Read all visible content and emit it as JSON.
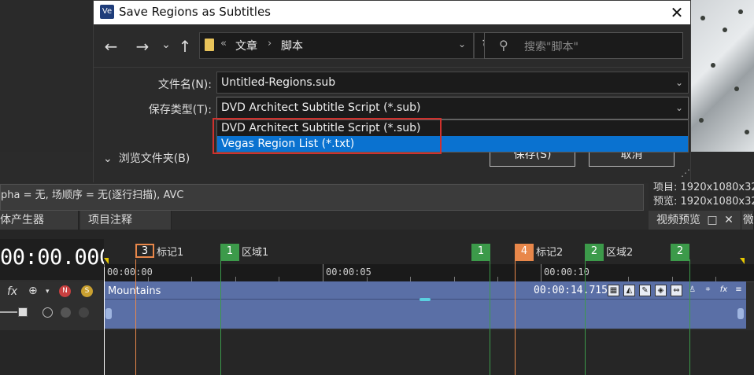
{
  "dialog": {
    "title": "Save Regions as Subtitles",
    "title_icon": "Ve",
    "nav": {
      "back": "←",
      "forward": "→",
      "recent": "⌄",
      "up": "↑",
      "refresh": "↻"
    },
    "breadcrumb": [
      "文章",
      "脚本"
    ],
    "breadcrumb_prefix": "«",
    "search_placeholder": "搜索\"脚本\"",
    "filename_label": "文件名(N):",
    "filename_value": "Untitled-Regions.sub",
    "filetype_label": "保存类型(T):",
    "filetype_value": "DVD Architect Subtitle Script (*.sub)",
    "filetype_options": [
      "DVD Architect Subtitle Script (*.sub)",
      "Vegas Region List (*.txt)"
    ],
    "filetype_highlighted": "Vegas Region List (*.txt)",
    "browse_folders": "浏览文件夹(B)",
    "save_button": "保存(S)",
    "cancel_button": "取消"
  },
  "background": {
    "media_info": "pha = 无, 场顺序 = 无(逐行扫描), AVC",
    "project_info": "项目: 1920x1080x32",
    "preview_info": "预览: 1920x1080x32",
    "tabs": [
      "体产生器",
      "项目注释"
    ],
    "video_preview_tab": "视频预览",
    "extra_tab": "微",
    "timecode": "00:00.000",
    "ruler_labels": [
      "00:00:00",
      "00:00:05",
      "00:00:10"
    ],
    "markers": [
      {
        "num": "3",
        "label": "标记1",
        "kind": "marker"
      },
      {
        "num": "1",
        "label": "区域1",
        "kind": "region"
      },
      {
        "num": "1",
        "label": "",
        "kind": "region"
      },
      {
        "num": "4",
        "label": "标记2",
        "kind": "marker"
      },
      {
        "num": "2",
        "label": "区域2",
        "kind": "region"
      },
      {
        "num": "2",
        "label": "",
        "kind": "region"
      }
    ],
    "clip_name": "Mountains",
    "clip_time": "00:00:14.715",
    "track_icons": [
      "fx",
      "⊕",
      "N",
      "S"
    ]
  },
  "colors": {
    "marker_orange": "#e8874a",
    "region_green": "#3c9a4a",
    "clip_blue": "#5a6fa6",
    "highlight_blue": "#0a72d0",
    "outline_red": "#d0312d"
  }
}
